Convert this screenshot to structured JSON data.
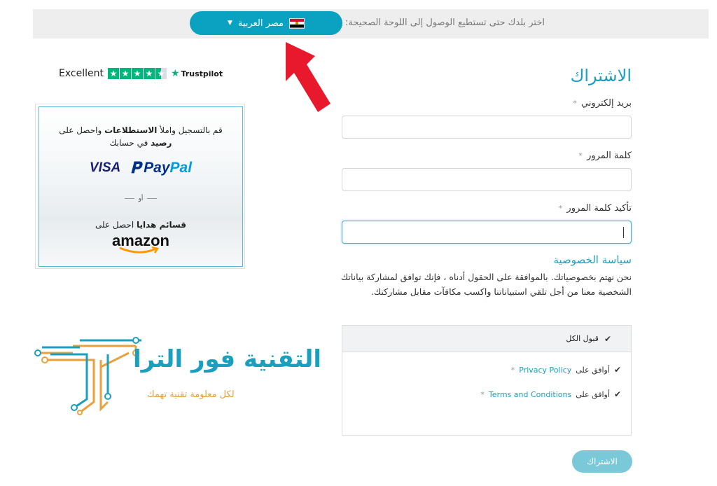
{
  "country_bar": {
    "prompt": "اختر بلدك حتى تستطيع الوصول إلى اللوحة الصحيحة:",
    "selected_country": "مصر العربية",
    "caret": "▼",
    "flag_icon": "egypt-flag-icon"
  },
  "form": {
    "title": "الاشتراك",
    "email_label": "بريد إلكتروني",
    "password_label": "كلمة المرور",
    "confirm_password_label": "تأكيد كلمة المرور",
    "required_mark": "*",
    "email_value": "",
    "password_value": "",
    "confirm_password_value": ""
  },
  "privacy": {
    "title": "سياسة الخصوصية",
    "text": "نحن نهتم بخصوصياتك. بالموافقة على الحقول أدناه ، فإنك توافق لمشاركة بياناتك الشخصية معنا من أجل تلقي استبياناتنا واكسب مكافآت مقابل مشاركتك."
  },
  "consent": {
    "accept_all": "قبول الكل",
    "agree_prefix": "أوافق على",
    "privacy_policy": "Privacy Policy",
    "terms": "Terms and Conditions",
    "required_mark": "*",
    "check_glyph": "✔"
  },
  "submit_label": "الاشتراك",
  "trustpilot": {
    "rating_text": "Excellent",
    "brand": "Trustpilot",
    "stars": 4.5
  },
  "ad": {
    "line1_a": "قم بالتسجيل واملأ ",
    "line1_b": "الاستطلاعات",
    "line1_c": " واحصل على",
    "line2_a": "رصيد",
    "line2_b": " في حسابك",
    "visa": "VISA",
    "paypal_a": "Pay",
    "paypal_b": "Pal",
    "or": "أو",
    "line3_a": "قسائم هدايا",
    "line3_b": " احصل على",
    "amazon": "amazon"
  },
  "logo": {
    "title": "التقنية فور الترا",
    "subtitle": "لكل معلومة تقنية تهمك"
  },
  "colors": {
    "accent": "#1aa0bd",
    "select_bg": "#0aa2c0",
    "arrow": "#e8192c",
    "trustpilot_green": "#00b67a",
    "logo_orange": "#e8a13c"
  }
}
